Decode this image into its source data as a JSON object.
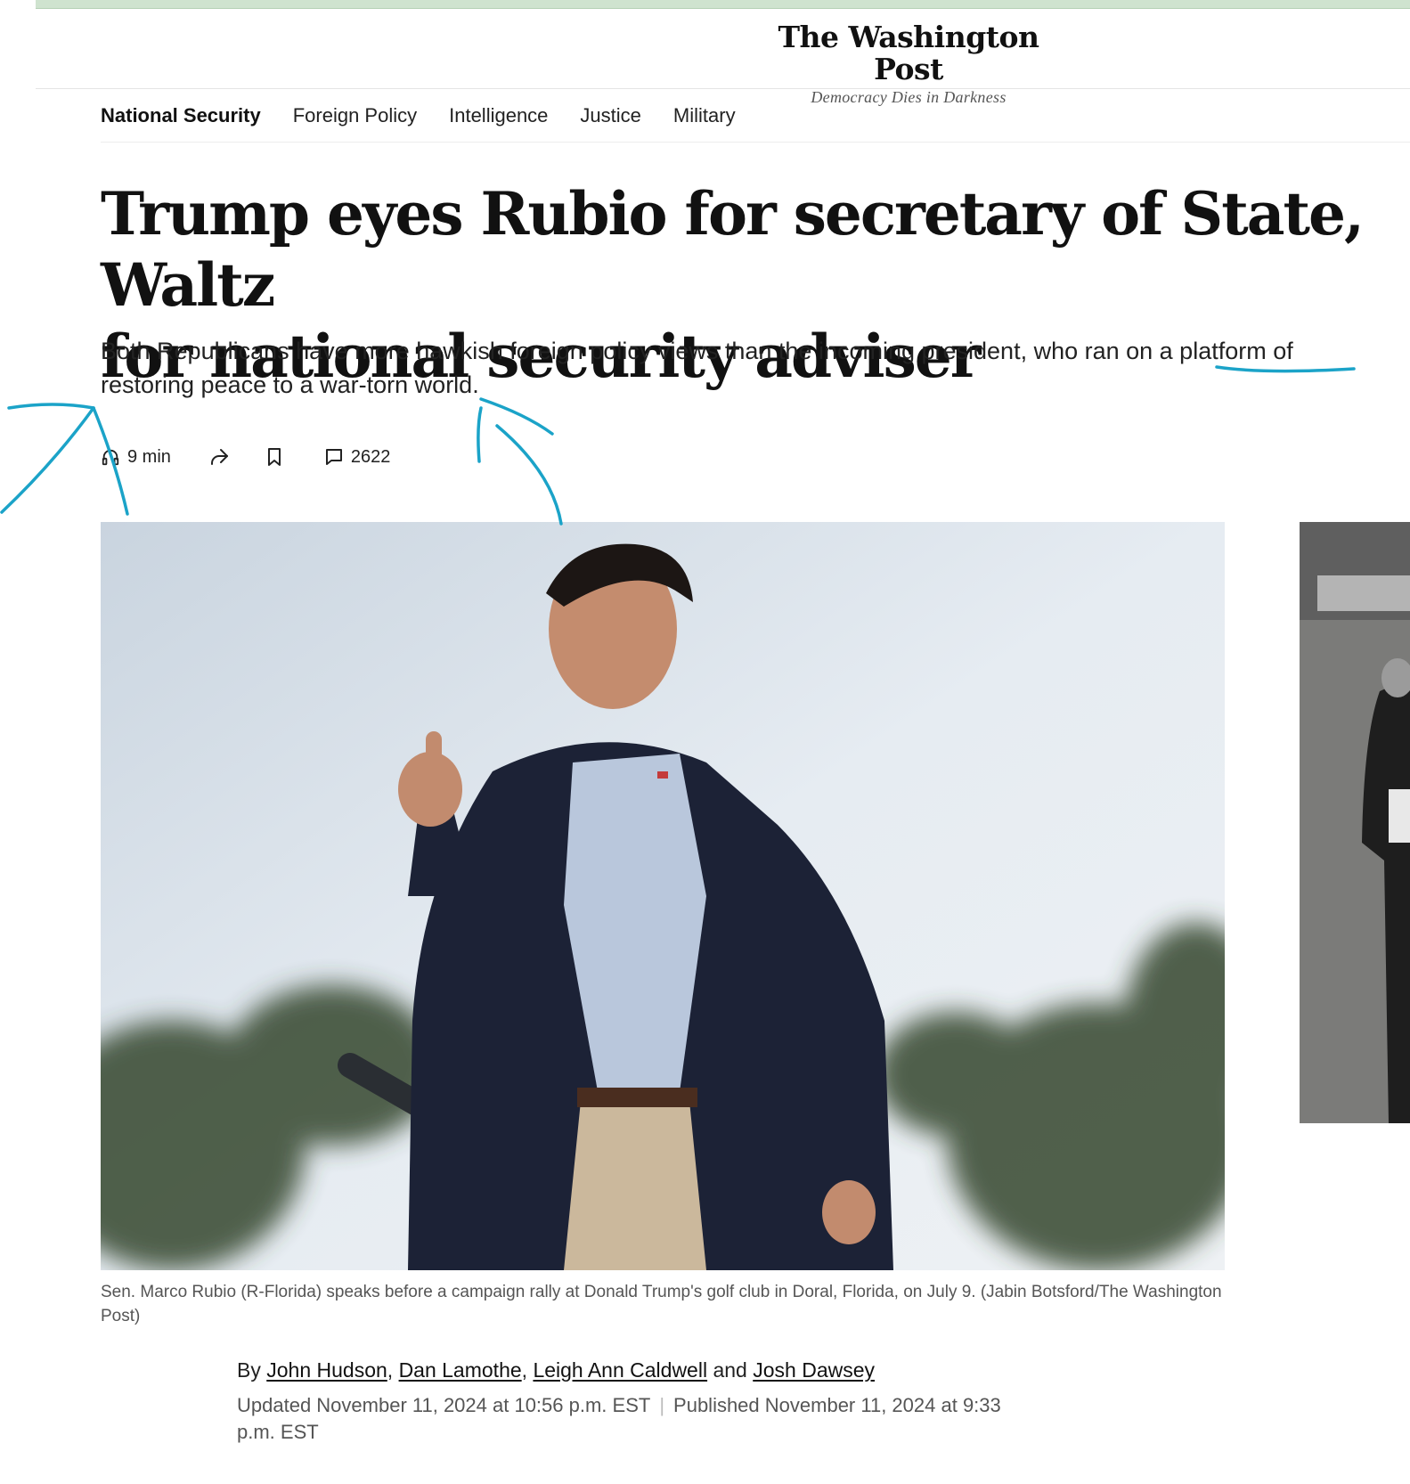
{
  "masthead": {
    "logo": "The Washington Post",
    "tagline": "Democracy Dies in Darkness"
  },
  "section_nav": {
    "items": [
      {
        "label": "National Security",
        "active": true
      },
      {
        "label": "Foreign Policy",
        "active": false
      },
      {
        "label": "Intelligence",
        "active": false
      },
      {
        "label": "Justice",
        "active": false
      },
      {
        "label": "Military",
        "active": false
      }
    ]
  },
  "article": {
    "headline_line1": "Trump eyes Rubio for secretary of State, Waltz",
    "headline_line2": "for national security adviser",
    "dek": "Both Republicans have more hawkish foreign policy views than the incoming president, who ran on a platform of restoring peace to a war-torn world.",
    "toolbar": {
      "listen_label": "9 min",
      "comment_count": "2622",
      "icons": [
        "headphones-icon",
        "share-icon",
        "bookmark-icon",
        "comment-icon"
      ]
    },
    "caption": "Sen. Marco Rubio (R-Florida) speaks before a campaign rally at Donald Trump's golf club in Doral, Florida, on July 9. (Jabin Botsford/The Washington Post)",
    "byline": {
      "prefix": "By",
      "authors": [
        "John Hudson",
        "Dan Lamothe",
        "Leigh Ann Caldwell",
        "Josh Dawsey"
      ],
      "sep1": ",",
      "sep2": ",",
      "and": "and"
    },
    "updated": "Updated November 11, 2024 at 10:56 p.m. EST",
    "published": "Published November 11, 2024 at 9:33 p.m. EST"
  },
  "colors": {
    "annotation_ink": "#1ba3c8",
    "top_strip": "#cfe3cf",
    "text": "#111111",
    "muted": "#555555"
  }
}
